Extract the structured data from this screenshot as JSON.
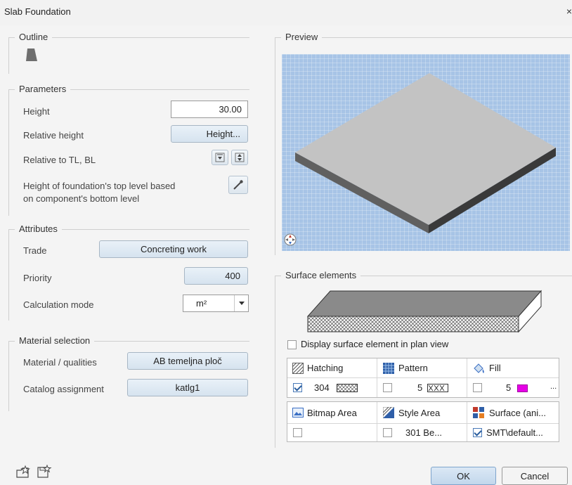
{
  "window": {
    "title": "Slab Foundation",
    "close_glyph": "×"
  },
  "outline": {
    "title": "Outline"
  },
  "parameters": {
    "title": "Parameters",
    "height_label": "Height",
    "height_value": "30.00",
    "relative_height_label": "Relative height",
    "relative_height_button": "Height...",
    "relative_to_label": "Relative to TL, BL",
    "top_level_label_line1": "Height of foundation's top level based",
    "top_level_label_line2": "on component's bottom level"
  },
  "attributes": {
    "title": "Attributes",
    "trade_label": "Trade",
    "trade_value": "Concreting work",
    "priority_label": "Priority",
    "priority_value": "400",
    "calc_mode_label": "Calculation mode",
    "calc_mode_value": "m²"
  },
  "material": {
    "title": "Material selection",
    "qualities_label": "Material / qualities",
    "qualities_value": "AB temeljna ploč",
    "catalog_label": "Catalog assignment",
    "catalog_value": "katlg1"
  },
  "preview": {
    "title": "Preview"
  },
  "surface": {
    "title": "Surface elements",
    "display_plan_label": "Display surface element in plan view",
    "display_plan_checked": false,
    "row1_headers": [
      "Hatching",
      "Pattern",
      "Fill"
    ],
    "row1_values": [
      "304",
      "5",
      "5"
    ],
    "row1_more": "...",
    "row1_checked": [
      true,
      false,
      false
    ],
    "fill_color": "#e600e6",
    "row2_headers": [
      "Bitmap Area",
      "Style Area",
      "Surface (ani..."
    ],
    "row2_values": [
      "",
      "301 Be...",
      "SMT\\default..."
    ],
    "row2_checked": [
      false,
      false,
      true
    ]
  },
  "footer": {
    "ok": "OK",
    "cancel": "Cancel"
  },
  "colors": {
    "accent_button": "#d6e3ef",
    "preview_bg": "#a7c4e6",
    "ok_button": "#cfe0f0"
  }
}
